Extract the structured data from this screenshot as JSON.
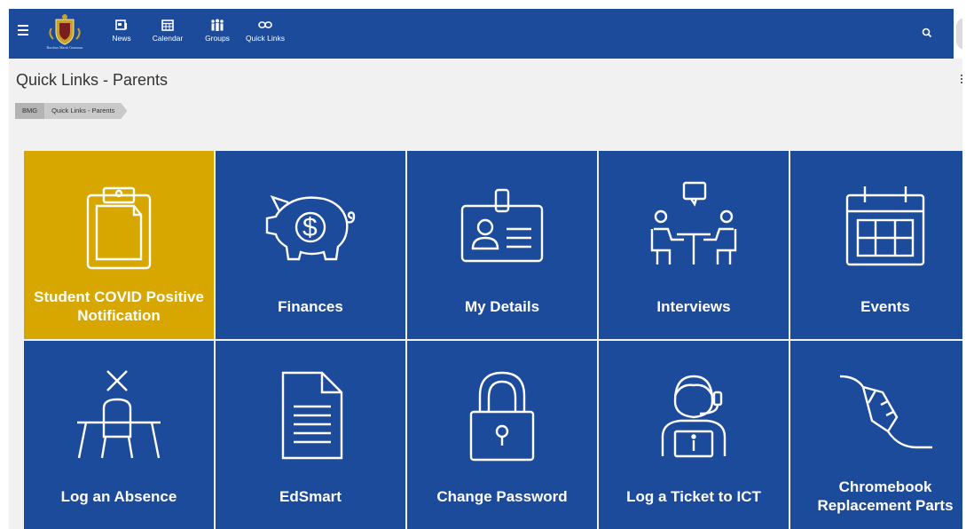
{
  "header": {
    "crest_text": "Bacchus Marsh Grammar",
    "nav": [
      {
        "label": "News",
        "icon": "news-icon"
      },
      {
        "label": "Calendar",
        "icon": "calendar-icon"
      },
      {
        "label": "Groups",
        "icon": "groups-icon"
      },
      {
        "label": "Quick Links",
        "icon": "link-icon"
      }
    ],
    "search_icon": "search-icon"
  },
  "page": {
    "title": "Quick Links - Parents",
    "breadcrumb": [
      "BMG",
      "Quick Links - Parents"
    ]
  },
  "colors": {
    "brand": "#1d4b9b",
    "highlight": "#d7a700",
    "background": "#f1f1f1"
  },
  "tiles": [
    {
      "label": "Student COVID Positive Notification",
      "icon": "clipboard-icon"
    },
    {
      "label": "Finances",
      "icon": "piggy-bank-icon"
    },
    {
      "label": "My Details",
      "icon": "id-badge-icon"
    },
    {
      "label": "Interviews",
      "icon": "interview-icon"
    },
    {
      "label": "Events",
      "icon": "calendar-grid-icon"
    },
    {
      "label": "Log an Absence",
      "icon": "empty-desk-icon"
    },
    {
      "label": "EdSmart",
      "icon": "document-icon"
    },
    {
      "label": "Change Password",
      "icon": "padlock-icon"
    },
    {
      "label": "Log a Ticket to ICT",
      "icon": "helpdesk-icon"
    },
    {
      "label": "Chromebook Replacement Parts",
      "icon": "power-plug-icon"
    }
  ]
}
